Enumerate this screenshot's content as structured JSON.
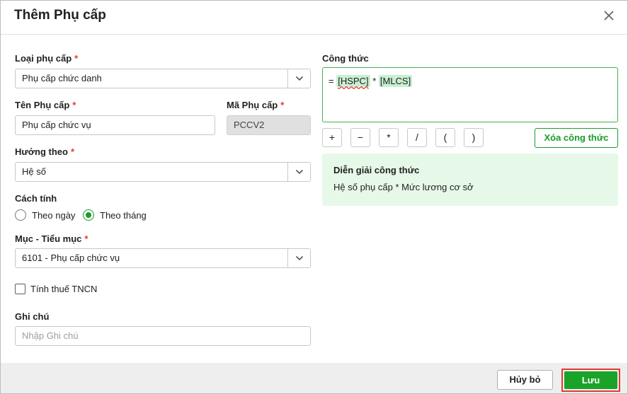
{
  "dialog": {
    "title": "Thêm Phụ cấp"
  },
  "form": {
    "loai_phu_cap": {
      "label": "Loại phụ cấp",
      "required_mark": "*",
      "value": "Phụ cấp chức danh"
    },
    "ten_phu_cap": {
      "label": "Tên Phụ cấp",
      "required_mark": "*",
      "value": "Phụ cấp chức vụ"
    },
    "ma_phu_cap": {
      "label": "Mã Phụ cấp",
      "required_mark": "*",
      "value": "PCCV2"
    },
    "huong_theo": {
      "label": "Hưởng theo",
      "required_mark": "*",
      "value": "Hệ số"
    },
    "cach_tinh": {
      "label": "Cách tính",
      "options": [
        "Theo ngày",
        "Theo tháng"
      ],
      "selected": "Theo tháng"
    },
    "muc_tieu_muc": {
      "label": "Mục - Tiểu mục",
      "required_mark": "*",
      "value": "6101 - Phụ cấp chức vụ"
    },
    "tinh_thue": {
      "label": "Tính thuế TNCN",
      "checked": false
    },
    "ghi_chu": {
      "label": "Ghi chú",
      "placeholder": "Nhập Ghi chú"
    }
  },
  "formula": {
    "label": "Công thức",
    "prefix": "=",
    "token1": "[HSPC]",
    "operator": "*",
    "token2": "[MLCS]",
    "operators": [
      "+",
      "−",
      "*",
      "/",
      "(",
      ")"
    ],
    "clear_label": "Xóa công thức",
    "explain_title": "Diễn giải công thức",
    "explain_text": "Hệ số phụ cấp * Mức lương cơ sở"
  },
  "footer": {
    "cancel_label": "Hủy bỏ",
    "save_label": "Lưu"
  },
  "colors": {
    "accent_green": "#1aa329",
    "required_red": "#e53935",
    "token_bg": "#c8f0d2",
    "explain_bg": "#e6f9e9"
  },
  "icons": {
    "close": "close-icon",
    "dropdown": "chevron-down-icon"
  }
}
